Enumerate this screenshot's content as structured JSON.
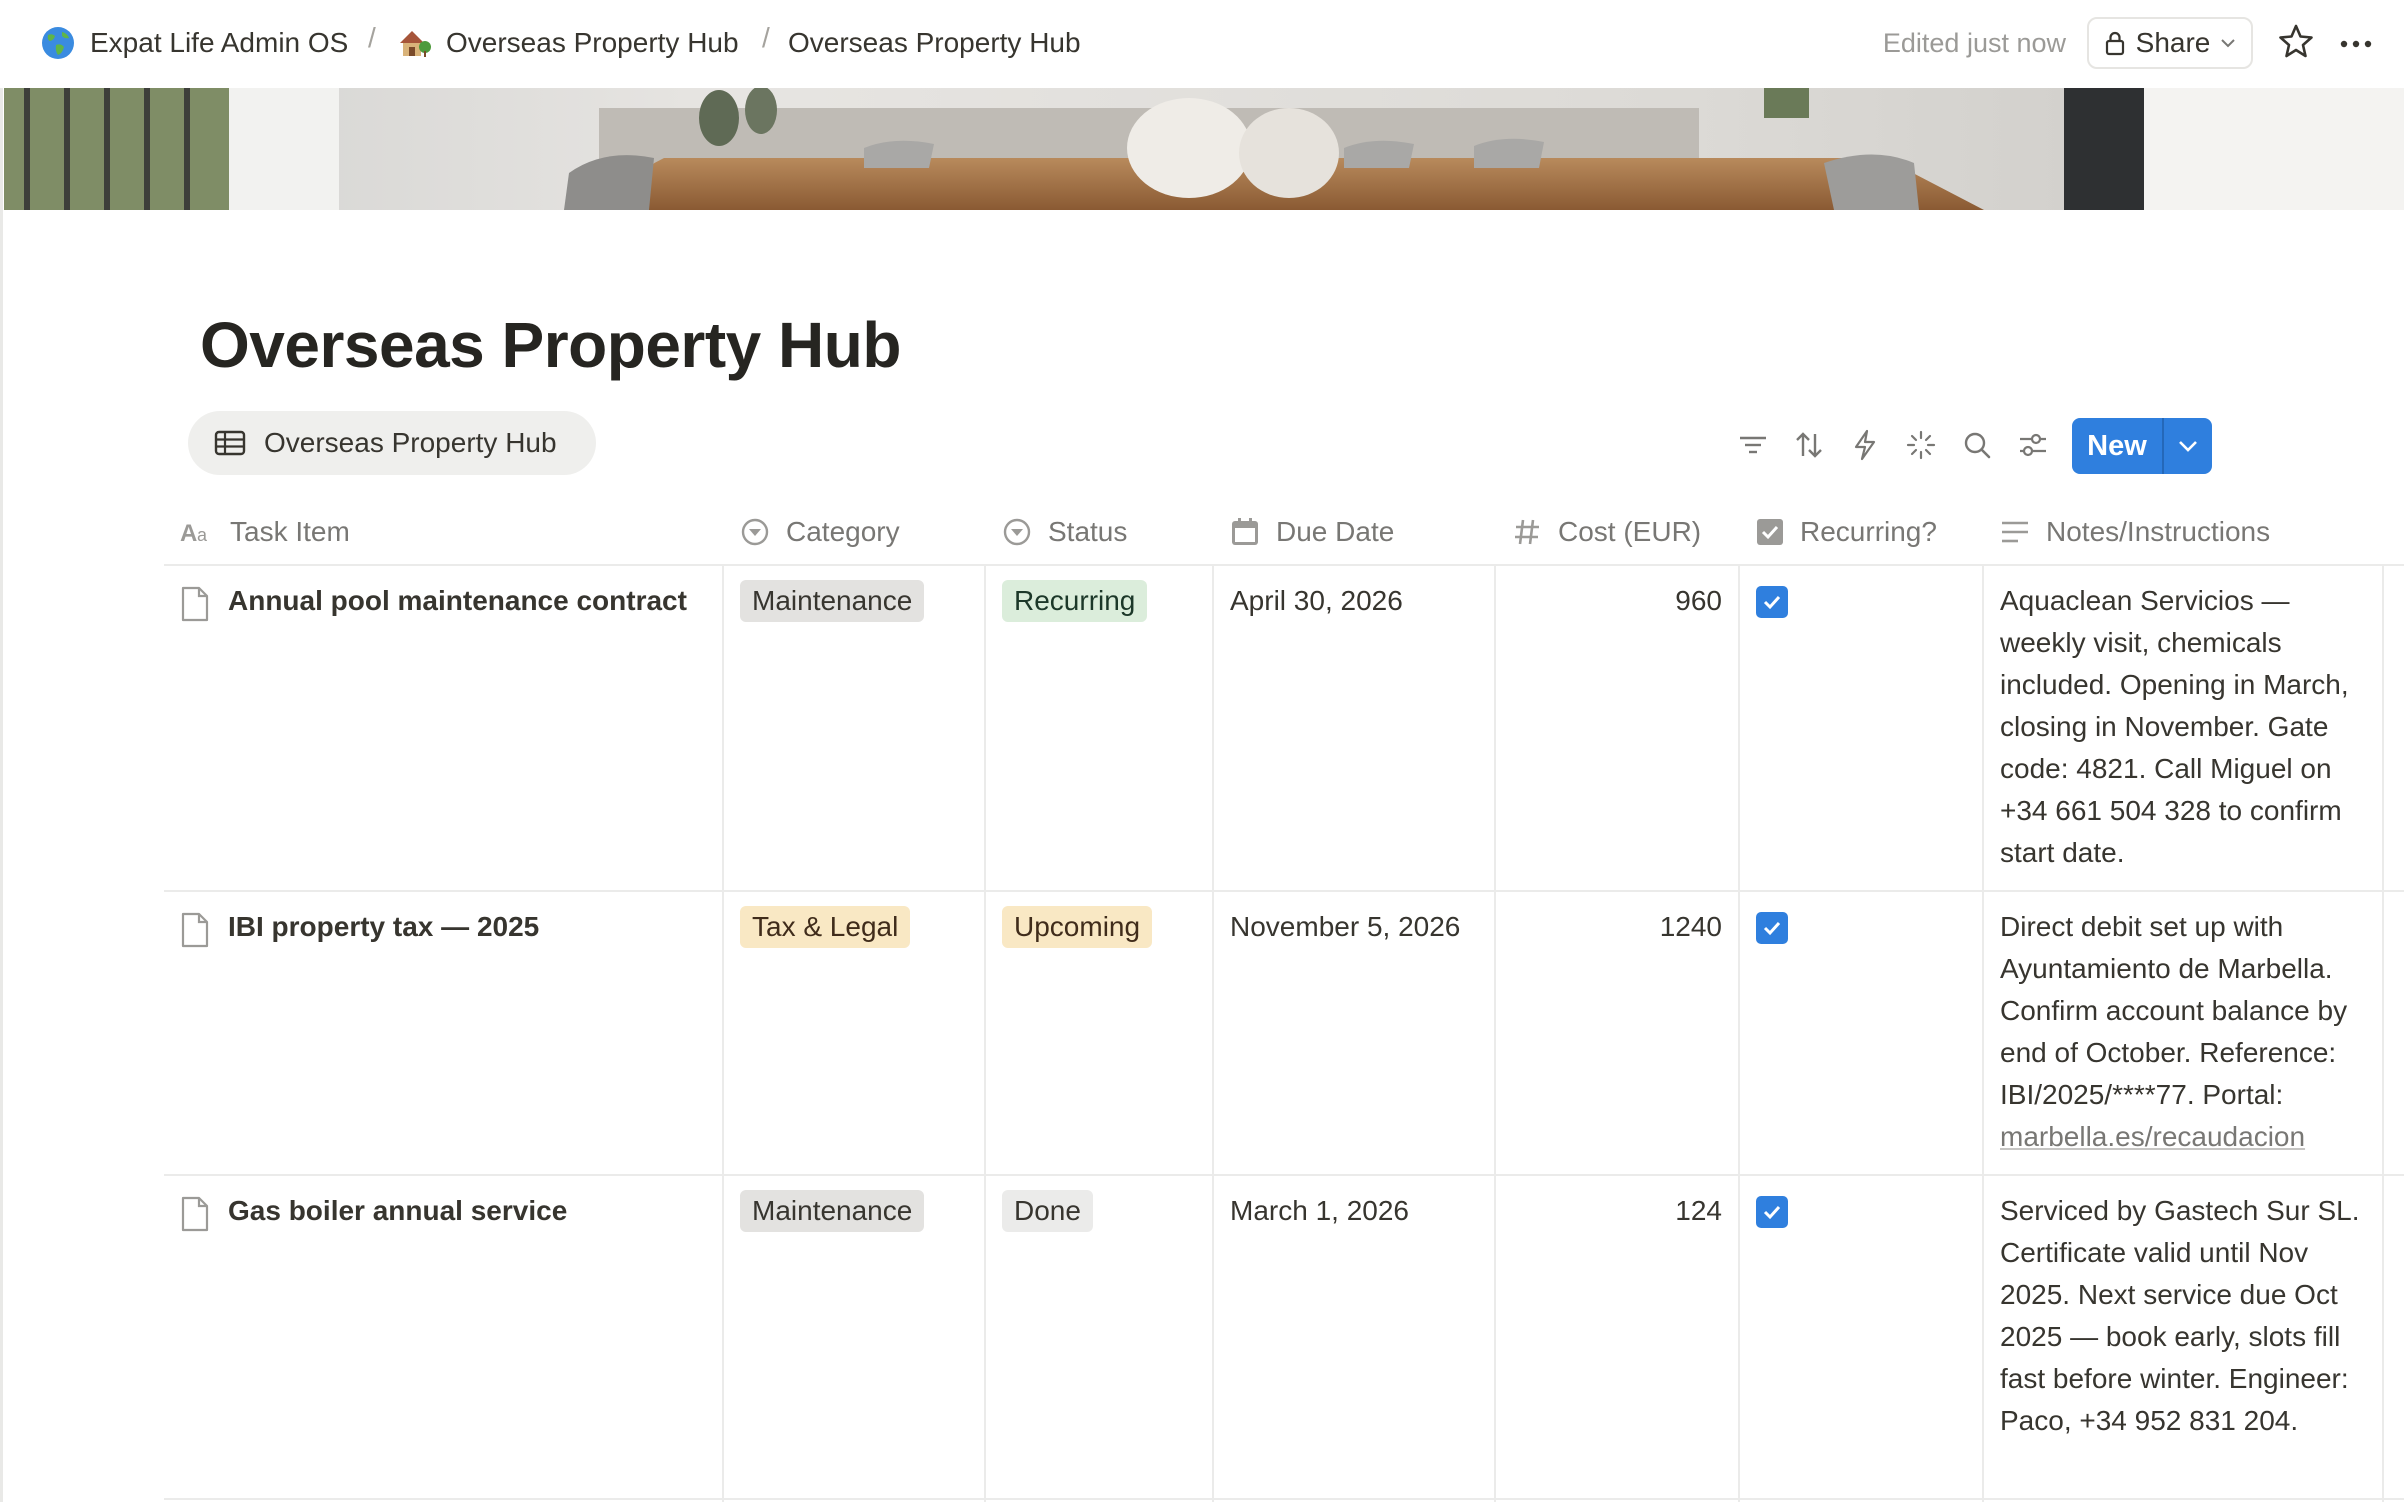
{
  "breadcrumb": [
    {
      "label": "Expat Life Admin OS",
      "icon": "globe-emoji"
    },
    {
      "label": "Overseas Property Hub",
      "icon": "house-emoji"
    },
    {
      "label": "Overseas Property Hub"
    }
  ],
  "topbar": {
    "edited": "Edited just now",
    "share_label": "Share"
  },
  "page": {
    "title": "Overseas Property Hub"
  },
  "view": {
    "tab_label": "Overseas Property Hub",
    "tab_icon": "table-icon"
  },
  "toolbar": {
    "icons": [
      "filter-icon",
      "sort-icon",
      "automation-icon",
      "ai-sparkle-icon",
      "search-icon",
      "settings-icon"
    ],
    "new_label": "New"
  },
  "table": {
    "columns": [
      {
        "label": "Task Item",
        "icon": "text-icon"
      },
      {
        "label": "Category",
        "icon": "select-icon"
      },
      {
        "label": "Status",
        "icon": "status-icon"
      },
      {
        "label": "Due Date",
        "icon": "calendar-icon"
      },
      {
        "label": "Cost (EUR)",
        "icon": "number-icon"
      },
      {
        "label": "Recurring?",
        "icon": "checkbox-icon"
      },
      {
        "label": "Notes/Instructions",
        "icon": "notes-icon"
      }
    ],
    "rows": [
      {
        "task": "Annual pool maintenance contract",
        "category": "Maintenance",
        "status": "Recurring",
        "due": "April 30, 2026",
        "cost": "960",
        "recurring": true,
        "notes": "Aquaclean Servicios — weekly visit, chemicals included. Opening in March, closing in November. Gate code: 4821. Call Miguel on +34 661 504 328 to confirm start date."
      },
      {
        "task": "IBI property tax — 2025",
        "category": "Tax & Legal",
        "status": "Upcoming",
        "due": "November 5, 2026",
        "cost": "1240",
        "recurring": true,
        "notes": "Direct debit set up with Ayuntamiento de Marbella. Confirm account balance by end of October. Reference: IBI/2025/****77. Portal:",
        "notes_link": "marbella.es/recaudacion"
      },
      {
        "task": "Gas boiler annual service",
        "category": "Maintenance",
        "status": "Done",
        "due": "March 1, 2026",
        "cost": "124",
        "recurring": true,
        "notes": "Serviced by Gastech Sur SL. Certificate valid until Nov 2025. Next service due Oct 2025 — book early, slots fill fast before winter. Engineer: Paco, +34 952 831 204."
      }
    ]
  },
  "colors": {
    "accent": "#2f7fde",
    "tag_maintenance_bg": "#e3e2e0",
    "tag_tax_bg": "#f9e8c4",
    "status_recurring_bg": "#dbeddb",
    "status_upcoming_bg": "#f9e8c4",
    "status_done_bg": "#ebebea"
  }
}
